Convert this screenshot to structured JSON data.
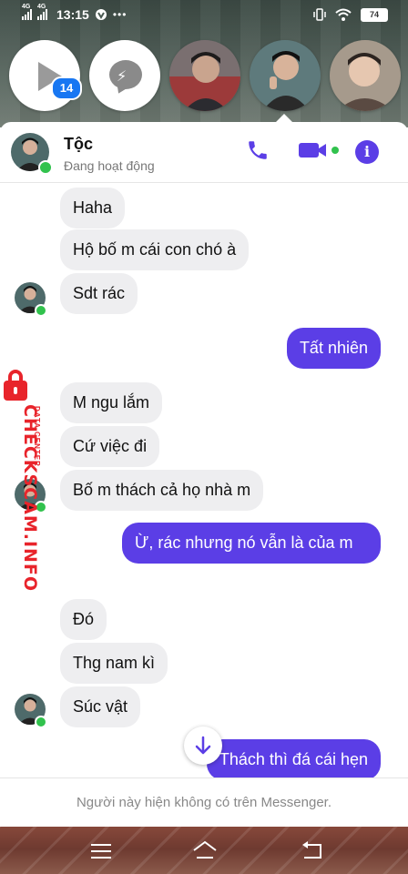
{
  "statusbar": {
    "sim1": "4G",
    "sim2": "4G",
    "time": "13:15",
    "battery": "74"
  },
  "chat_heads": {
    "video_badge": "14"
  },
  "header": {
    "name": "Tộc",
    "status": "Đang hoạt động"
  },
  "messages": [
    {
      "from": "them",
      "text": "Haha"
    },
    {
      "from": "them",
      "text": "Hộ bố m cái con chó à"
    },
    {
      "from": "them",
      "text": "Sdt rác"
    },
    {
      "from": "me",
      "text": "Tất nhiên"
    },
    {
      "from": "them",
      "text": "M ngu lắm"
    },
    {
      "from": "them",
      "text": "Cứ việc đi"
    },
    {
      "from": "them",
      "text": "Bố m thách cả họ nhà m"
    },
    {
      "from": "me",
      "text": "Ừ, rác nhưng nó vẫn là của m"
    },
    {
      "from": "them",
      "text": "Đó"
    },
    {
      "from": "them",
      "text": "Thg nam kì"
    },
    {
      "from": "them",
      "text": "Súc vật"
    },
    {
      "from": "me",
      "text": "Thách thì đá cái hẹn"
    }
  ],
  "footer": {
    "notice": "Người này hiện không có trên Messenger."
  },
  "watermark": {
    "brand": "CHECKSCAM.INFO",
    "sub": "DATA CENTER"
  },
  "colors": {
    "accent": "#5b3ee6",
    "incoming_bubble": "#eeeef0",
    "online": "#31c24d",
    "badge": "#1877f2",
    "watermark": "#e8242b"
  },
  "icons": {
    "call": "phone-icon",
    "video": "video-camera-icon",
    "info": "info-icon",
    "scroll": "arrow-down-icon"
  }
}
